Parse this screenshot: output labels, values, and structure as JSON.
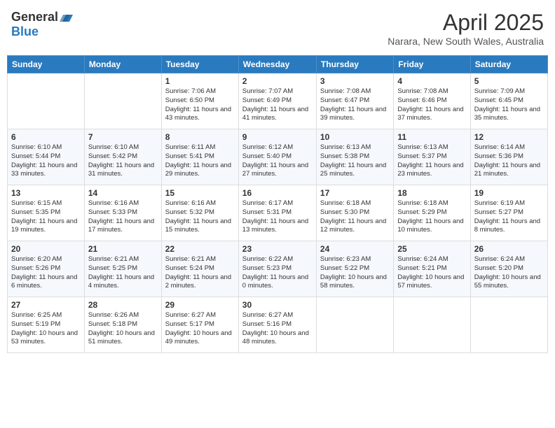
{
  "header": {
    "logo_general": "General",
    "logo_blue": "Blue",
    "month_year": "April 2025",
    "location": "Narara, New South Wales, Australia"
  },
  "calendar": {
    "days_of_week": [
      "Sunday",
      "Monday",
      "Tuesday",
      "Wednesday",
      "Thursday",
      "Friday",
      "Saturday"
    ],
    "weeks": [
      [
        {
          "day": "",
          "content": ""
        },
        {
          "day": "",
          "content": ""
        },
        {
          "day": "1",
          "content": "Sunrise: 7:06 AM\nSunset: 6:50 PM\nDaylight: 11 hours and 43 minutes."
        },
        {
          "day": "2",
          "content": "Sunrise: 7:07 AM\nSunset: 6:49 PM\nDaylight: 11 hours and 41 minutes."
        },
        {
          "day": "3",
          "content": "Sunrise: 7:08 AM\nSunset: 6:47 PM\nDaylight: 11 hours and 39 minutes."
        },
        {
          "day": "4",
          "content": "Sunrise: 7:08 AM\nSunset: 6:46 PM\nDaylight: 11 hours and 37 minutes."
        },
        {
          "day": "5",
          "content": "Sunrise: 7:09 AM\nSunset: 6:45 PM\nDaylight: 11 hours and 35 minutes."
        }
      ],
      [
        {
          "day": "6",
          "content": "Sunrise: 6:10 AM\nSunset: 5:44 PM\nDaylight: 11 hours and 33 minutes."
        },
        {
          "day": "7",
          "content": "Sunrise: 6:10 AM\nSunset: 5:42 PM\nDaylight: 11 hours and 31 minutes."
        },
        {
          "day": "8",
          "content": "Sunrise: 6:11 AM\nSunset: 5:41 PM\nDaylight: 11 hours and 29 minutes."
        },
        {
          "day": "9",
          "content": "Sunrise: 6:12 AM\nSunset: 5:40 PM\nDaylight: 11 hours and 27 minutes."
        },
        {
          "day": "10",
          "content": "Sunrise: 6:13 AM\nSunset: 5:38 PM\nDaylight: 11 hours and 25 minutes."
        },
        {
          "day": "11",
          "content": "Sunrise: 6:13 AM\nSunset: 5:37 PM\nDaylight: 11 hours and 23 minutes."
        },
        {
          "day": "12",
          "content": "Sunrise: 6:14 AM\nSunset: 5:36 PM\nDaylight: 11 hours and 21 minutes."
        }
      ],
      [
        {
          "day": "13",
          "content": "Sunrise: 6:15 AM\nSunset: 5:35 PM\nDaylight: 11 hours and 19 minutes."
        },
        {
          "day": "14",
          "content": "Sunrise: 6:16 AM\nSunset: 5:33 PM\nDaylight: 11 hours and 17 minutes."
        },
        {
          "day": "15",
          "content": "Sunrise: 6:16 AM\nSunset: 5:32 PM\nDaylight: 11 hours and 15 minutes."
        },
        {
          "day": "16",
          "content": "Sunrise: 6:17 AM\nSunset: 5:31 PM\nDaylight: 11 hours and 13 minutes."
        },
        {
          "day": "17",
          "content": "Sunrise: 6:18 AM\nSunset: 5:30 PM\nDaylight: 11 hours and 12 minutes."
        },
        {
          "day": "18",
          "content": "Sunrise: 6:18 AM\nSunset: 5:29 PM\nDaylight: 11 hours and 10 minutes."
        },
        {
          "day": "19",
          "content": "Sunrise: 6:19 AM\nSunset: 5:27 PM\nDaylight: 11 hours and 8 minutes."
        }
      ],
      [
        {
          "day": "20",
          "content": "Sunrise: 6:20 AM\nSunset: 5:26 PM\nDaylight: 11 hours and 6 minutes."
        },
        {
          "day": "21",
          "content": "Sunrise: 6:21 AM\nSunset: 5:25 PM\nDaylight: 11 hours and 4 minutes."
        },
        {
          "day": "22",
          "content": "Sunrise: 6:21 AM\nSunset: 5:24 PM\nDaylight: 11 hours and 2 minutes."
        },
        {
          "day": "23",
          "content": "Sunrise: 6:22 AM\nSunset: 5:23 PM\nDaylight: 11 hours and 0 minutes."
        },
        {
          "day": "24",
          "content": "Sunrise: 6:23 AM\nSunset: 5:22 PM\nDaylight: 10 hours and 58 minutes."
        },
        {
          "day": "25",
          "content": "Sunrise: 6:24 AM\nSunset: 5:21 PM\nDaylight: 10 hours and 57 minutes."
        },
        {
          "day": "26",
          "content": "Sunrise: 6:24 AM\nSunset: 5:20 PM\nDaylight: 10 hours and 55 minutes."
        }
      ],
      [
        {
          "day": "27",
          "content": "Sunrise: 6:25 AM\nSunset: 5:19 PM\nDaylight: 10 hours and 53 minutes."
        },
        {
          "day": "28",
          "content": "Sunrise: 6:26 AM\nSunset: 5:18 PM\nDaylight: 10 hours and 51 minutes."
        },
        {
          "day": "29",
          "content": "Sunrise: 6:27 AM\nSunset: 5:17 PM\nDaylight: 10 hours and 49 minutes."
        },
        {
          "day": "30",
          "content": "Sunrise: 6:27 AM\nSunset: 5:16 PM\nDaylight: 10 hours and 48 minutes."
        },
        {
          "day": "",
          "content": ""
        },
        {
          "day": "",
          "content": ""
        },
        {
          "day": "",
          "content": ""
        }
      ]
    ]
  }
}
